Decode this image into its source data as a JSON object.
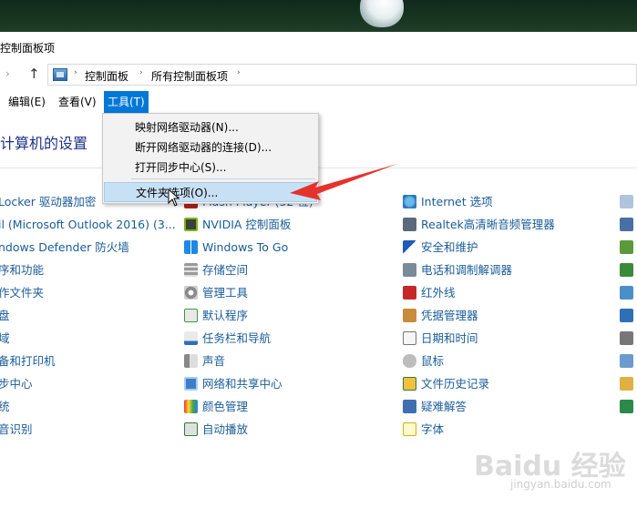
{
  "window": {
    "title": "控制面板项"
  },
  "address_bar": {
    "crumbs": [
      "控制面板",
      "所有控制面板项"
    ]
  },
  "menubar": {
    "items": [
      {
        "label": "编辑(E)"
      },
      {
        "label": "查看(V)"
      },
      {
        "label": "工具(T)",
        "active": true
      }
    ]
  },
  "tools_menu": {
    "items": [
      {
        "label": "映射网络驱动器(N)..."
      },
      {
        "label": "断开网络驱动器的连接(D)..."
      },
      {
        "label": "打开同步中心(S)..."
      },
      {
        "label": "文件夹选项(O)...",
        "highlighted": true
      }
    ]
  },
  "heading": "计算机的设置",
  "columns": {
    "col1": [
      {
        "label": "Locker 驱动器加密",
        "icon": "bitlocker-icon"
      },
      {
        "label": "il (Microsoft Outlook 2016) (3...",
        "icon": "mail-icon"
      },
      {
        "label": "ndows Defender 防火墙",
        "icon": "firewall-icon"
      },
      {
        "label": "序和功能",
        "icon": "programs-icon"
      },
      {
        "label": "作文件夹",
        "icon": "work-folders-icon"
      },
      {
        "label": "盘",
        "icon": "keyboard-icon"
      },
      {
        "label": "域",
        "icon": "region-icon"
      },
      {
        "label": "备和打印机",
        "icon": "devices-printers-icon"
      },
      {
        "label": "步中心",
        "icon": "sync-center-icon"
      },
      {
        "label": "统",
        "icon": "system-icon"
      },
      {
        "label": "音识别",
        "icon": "speech-icon"
      }
    ],
    "col2": [
      {
        "label": "Flash Player (32 位)",
        "icon": "flash-icon"
      },
      {
        "label": "NVIDIA 控制面板",
        "icon": "nvidia-icon"
      },
      {
        "label": "Windows To Go",
        "icon": "windows-to-go-icon"
      },
      {
        "label": "存储空间",
        "icon": "storage-spaces-icon"
      },
      {
        "label": "管理工具",
        "icon": "admin-tools-icon"
      },
      {
        "label": "默认程序",
        "icon": "default-programs-icon"
      },
      {
        "label": "任务栏和导航",
        "icon": "taskbar-icon"
      },
      {
        "label": "声音",
        "icon": "sound-icon"
      },
      {
        "label": "网络和共享中心",
        "icon": "network-icon"
      },
      {
        "label": "颜色管理",
        "icon": "color-management-icon"
      },
      {
        "label": "自动播放",
        "icon": "autoplay-icon"
      }
    ],
    "col3": [
      {
        "label": "Internet 选项",
        "icon": "internet-options-icon"
      },
      {
        "label": "Realtek高清晰音频管理器",
        "icon": "realtek-icon"
      },
      {
        "label": "安全和维护",
        "icon": "security-flag-icon"
      },
      {
        "label": "电话和调制解调器",
        "icon": "phone-modem-icon"
      },
      {
        "label": "红外线",
        "icon": "infrared-icon"
      },
      {
        "label": "凭据管理器",
        "icon": "credential-icon"
      },
      {
        "label": "日期和时间",
        "icon": "date-time-icon"
      },
      {
        "label": "鼠标",
        "icon": "mouse-icon"
      },
      {
        "label": "文件历史记录",
        "icon": "file-history-icon"
      },
      {
        "label": "疑难解答",
        "icon": "troubleshoot-icon"
      },
      {
        "label": "字体",
        "icon": "fonts-icon"
      }
    ]
  },
  "watermark": {
    "main": "Baidu 经验",
    "sub": "jingyan.baidu.com"
  },
  "colors": {
    "link": "#1a5c99",
    "menu_active": "#0078d7",
    "menu_hover": "#c8e0f4",
    "arrow": "#e5322d"
  }
}
